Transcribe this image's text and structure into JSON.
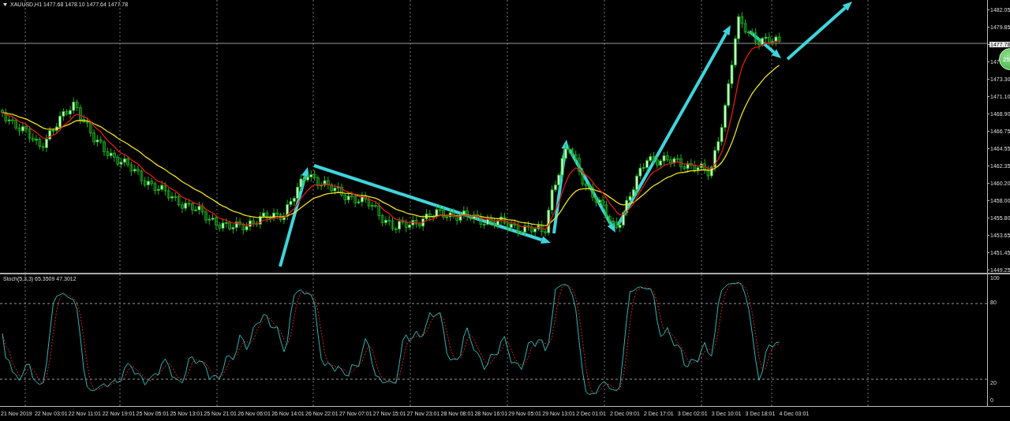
{
  "chart": {
    "title": "XAUUSD,H1 1477.68 1478.10 1477.64 1477.78"
  },
  "price_axis": {
    "ticks": [
      {
        "kind": "tick",
        "label": "1482.05"
      },
      {
        "kind": "tick",
        "label": "1479.85"
      },
      {
        "kind": "current",
        "label": "1477.78"
      },
      {
        "kind": "tick",
        "label": "147"
      },
      {
        "kind": "tick",
        "label": "1473.30"
      },
      {
        "kind": "tick",
        "label": "1471.10"
      },
      {
        "kind": "tick",
        "label": "1468.90"
      },
      {
        "kind": "tick",
        "label": "1466.75"
      },
      {
        "kind": "tick",
        "label": "1464.55"
      },
      {
        "kind": "tick",
        "label": "1462.35"
      },
      {
        "kind": "tick",
        "label": "1460.20"
      },
      {
        "kind": "tick",
        "label": "1458.00"
      },
      {
        "kind": "tick",
        "label": "1455.80"
      },
      {
        "kind": "tick",
        "label": "1453.65"
      },
      {
        "kind": "tick",
        "label": "1451.45"
      },
      {
        "kind": "tick",
        "label": "1449.25"
      }
    ]
  },
  "badge": {
    "label": "25"
  },
  "indicator": {
    "title": "Stoch(5,3,3) 65.3509 47.3012",
    "ticks": [
      "100",
      "80",
      "20",
      "0"
    ]
  },
  "time_axis": {
    "labels": [
      "21 Nov 2019",
      "22 Nov 03:01",
      "22 Nov 11:01",
      "22 Nov 19:01",
      "25 Nov 05:01",
      "25 Nov 13:01",
      "25 Nov 21:01",
      "26 Nov 06:01",
      "26 Nov 14:01",
      "26 Nov 22:01",
      "27 Nov 07:01",
      "27 Nov 15:01",
      "27 Nov 23:01",
      "28 Nov 08:01",
      "28 Nov 16:01",
      "29 Nov 05:01",
      "29 Nov 13:01",
      "2 Dec 01:01",
      "2 Dec 09:01",
      "2 Dec 17:01",
      "3 Dec 02:01",
      "3 Dec 10:01",
      "3 Dec 18:01",
      "4 Dec 03:01"
    ]
  }
}
